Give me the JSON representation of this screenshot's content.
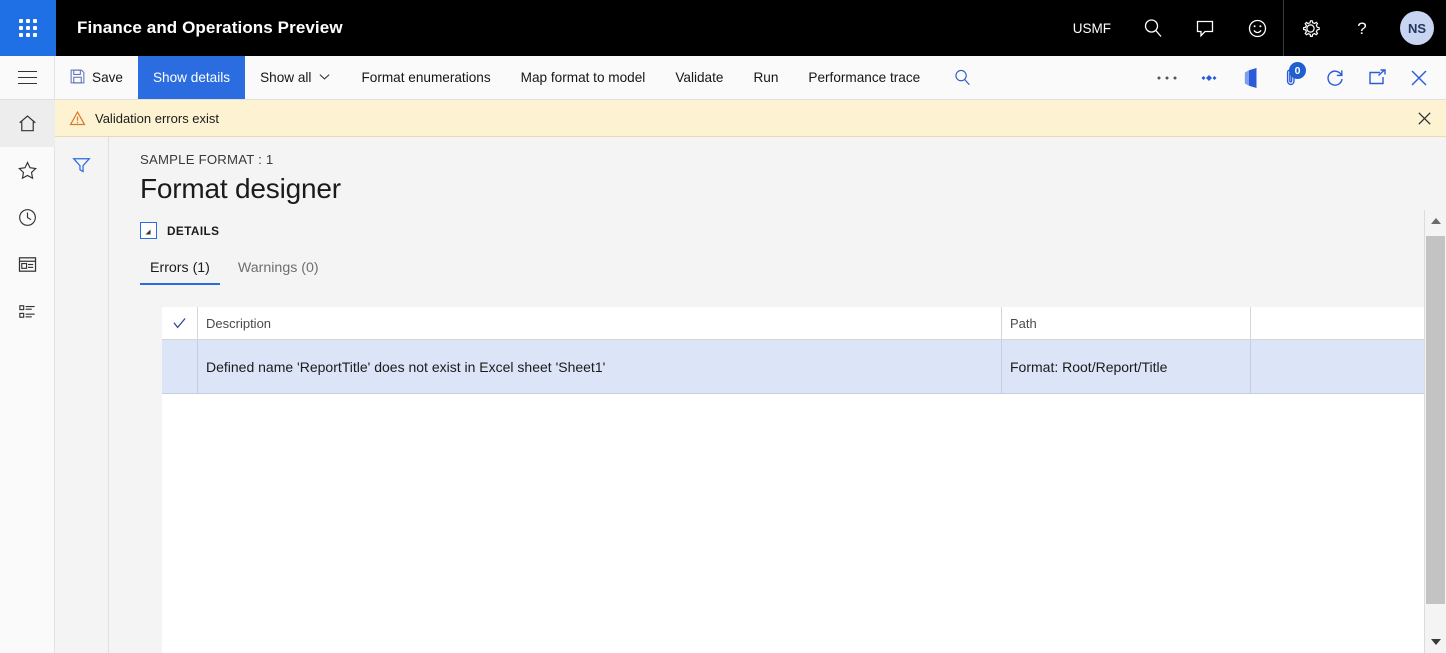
{
  "appbar": {
    "waffle_icon": "app-launcher-icon",
    "title": "Finance and Operations Preview",
    "company": "USMF",
    "icons": [
      {
        "name": "search-icon",
        "label": "Search"
      },
      {
        "name": "message-icon",
        "label": "Messages"
      },
      {
        "name": "feedback-smiley-icon",
        "label": "Feedback"
      },
      {
        "name": "gear-icon",
        "label": "Settings"
      },
      {
        "name": "help-icon",
        "label": "Help"
      }
    ],
    "avatar_initials": "NS"
  },
  "commandbar": {
    "hamburger_icon": "navigation-menu-icon",
    "buttons": [
      {
        "name": "save-button",
        "label": "Save",
        "icon": "save-icon",
        "active": false
      },
      {
        "name": "show-details-button",
        "label": "Show details",
        "icon": "",
        "active": true
      },
      {
        "name": "show-all-button",
        "label": "Show all",
        "icon": "chevron-down-icon",
        "active": false
      },
      {
        "name": "format-enumerations-button",
        "label": "Format enumerations",
        "icon": "",
        "active": false
      },
      {
        "name": "map-format-to-model-button",
        "label": "Map format to model",
        "icon": "",
        "active": false
      },
      {
        "name": "validate-button",
        "label": "Validate",
        "icon": "",
        "active": false
      },
      {
        "name": "run-button",
        "label": "Run",
        "icon": "",
        "active": false
      },
      {
        "name": "performance-trace-button",
        "label": "Performance trace",
        "icon": "",
        "active": false
      }
    ],
    "right_icons": [
      {
        "name": "toolbar-search-icon",
        "label": "Search"
      },
      {
        "name": "overflow-ellipsis-icon",
        "label": "More"
      },
      {
        "name": "share-diamond-icon",
        "label": "Share"
      },
      {
        "name": "open-in-office-icon",
        "label": "Open in Microsoft Office"
      },
      {
        "name": "attachments-icon",
        "label": "Attachments",
        "badge": "0"
      },
      {
        "name": "refresh-icon",
        "label": "Refresh"
      },
      {
        "name": "popout-icon",
        "label": "Open in new window"
      },
      {
        "name": "close-icon",
        "label": "Close"
      }
    ]
  },
  "messagebar": {
    "icon": "warning-triangle-icon",
    "text": "Validation errors exist",
    "close_label": "Close",
    "background": "#fdf3d2"
  },
  "rail": {
    "items": [
      {
        "name": "sidebar-item-home",
        "icon": "home-icon",
        "selected": true
      },
      {
        "name": "sidebar-item-favorites",
        "icon": "star-icon",
        "selected": false
      },
      {
        "name": "sidebar-item-recent",
        "icon": "clock-icon",
        "selected": false
      },
      {
        "name": "sidebar-item-workspaces",
        "icon": "workspace-icon",
        "selected": false
      },
      {
        "name": "sidebar-item-modules",
        "icon": "list-icon",
        "selected": false
      }
    ]
  },
  "filter_panel": {
    "icon": "filter-funnel-icon",
    "label": "Filter"
  },
  "main": {
    "breadcrumb": "SAMPLE FORMAT : 1",
    "page_title": "Format designer",
    "details_section_label": "DETAILS",
    "collapse_icon": "collapse-triangle-icon",
    "tabs": [
      {
        "name": "tab-errors",
        "label": "Errors (1)",
        "active": true
      },
      {
        "name": "tab-warnings",
        "label": "Warnings (0)",
        "active": false
      }
    ],
    "grid": {
      "select_all_icon": "checkmark-icon",
      "columns": [
        {
          "name": "column-description",
          "label": "Description"
        },
        {
          "name": "column-path",
          "label": "Path"
        }
      ],
      "rows": [
        {
          "description": "Defined name 'ReportTitle' does not exist in Excel sheet 'Sheet1'",
          "path": "Format: Root/Report/Title",
          "selected": true
        }
      ]
    }
  },
  "scrollbar": {
    "up_icon": "scroll-up-arrow-icon",
    "down_icon": "scroll-down-arrow-icon",
    "thumb_name": "scroll-thumb"
  },
  "colors": {
    "accent": "#2b6ce0",
    "appbar_bg": "#000000",
    "waffle_bg": "#1f6fe5",
    "warning_bg": "#fdf3d2",
    "row_selected": "#dce4f7"
  }
}
